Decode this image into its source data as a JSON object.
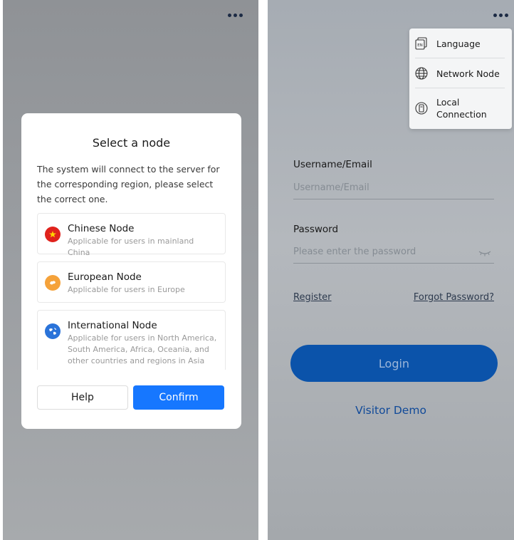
{
  "left_screen": {
    "dialog": {
      "title": "Select a node",
      "description": "The system will connect to the server for the corresponding region, please select the correct one.",
      "nodes": [
        {
          "name": "Chinese Node",
          "subtitle": "Applicable for users in mainland China",
          "icon": "china-flag-icon",
          "color": "#e0221c"
        },
        {
          "name": "European Node",
          "subtitle": "Applicable for users in Europe",
          "icon": "europe-icon",
          "color": "#f5a23a"
        },
        {
          "name": "International Node",
          "subtitle": "Applicable for users in North America, South America, Africa, Oceania, and other countries and regions in Asia",
          "icon": "globe-icon",
          "color": "#2a73d9"
        }
      ],
      "help_label": "Help",
      "confirm_label": "Confirm"
    }
  },
  "right_screen": {
    "menu": {
      "items": [
        {
          "label": "Language",
          "icon": "language-icon"
        },
        {
          "label": "Network Node",
          "icon": "network-globe-icon"
        },
        {
          "label": "Local\nConnection",
          "icon": "local-connection-icon"
        }
      ]
    },
    "form": {
      "username_label": "Username/Email",
      "username_placeholder": "Username/Email",
      "password_label": "Password",
      "password_placeholder": "Please enter the password",
      "register_label": "Register",
      "forgot_label": "Forgot Password?",
      "login_label": "Login",
      "visitor_label": "Visitor Demo"
    }
  },
  "colors": {
    "primary": "#1677ff",
    "login_button": "#0b53aa",
    "visitor_link": "#114a99"
  }
}
